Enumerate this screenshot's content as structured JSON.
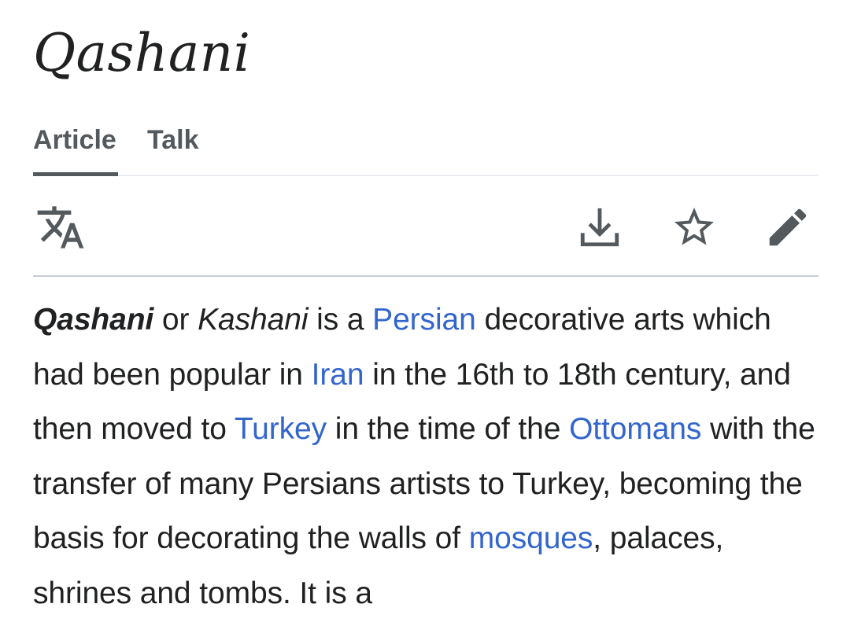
{
  "page": {
    "title": "Qashani"
  },
  "tabs": [
    {
      "label": "Article",
      "selected": true
    },
    {
      "label": "Talk",
      "selected": false
    }
  ],
  "toolbar": {
    "icons": [
      "language-icon",
      "download-icon",
      "star-icon",
      "edit-icon"
    ]
  },
  "article": {
    "subject": "Qashani",
    "t1": " or ",
    "alt_name": "Kashani",
    "t2": " is a ",
    "link_persian": "Persian",
    "t3": " decorative arts which had been popular in ",
    "link_iran": "Iran",
    "t4": " in the 16th to 18th century, and then moved to ",
    "link_turkey": "Turkey",
    "t5": " in the time of the ",
    "link_ottomans": "Ottomans",
    "t6": " with the transfer of many Persians artists to Turkey, becoming the basis for decorating the walls of ",
    "link_mosques": "mosques",
    "t7": ", palaces, shrines and tombs. It is a"
  },
  "colors": {
    "text": "#202122",
    "link": "#3366cc",
    "icon": "#54595d",
    "divider": "#c8ccd1"
  }
}
